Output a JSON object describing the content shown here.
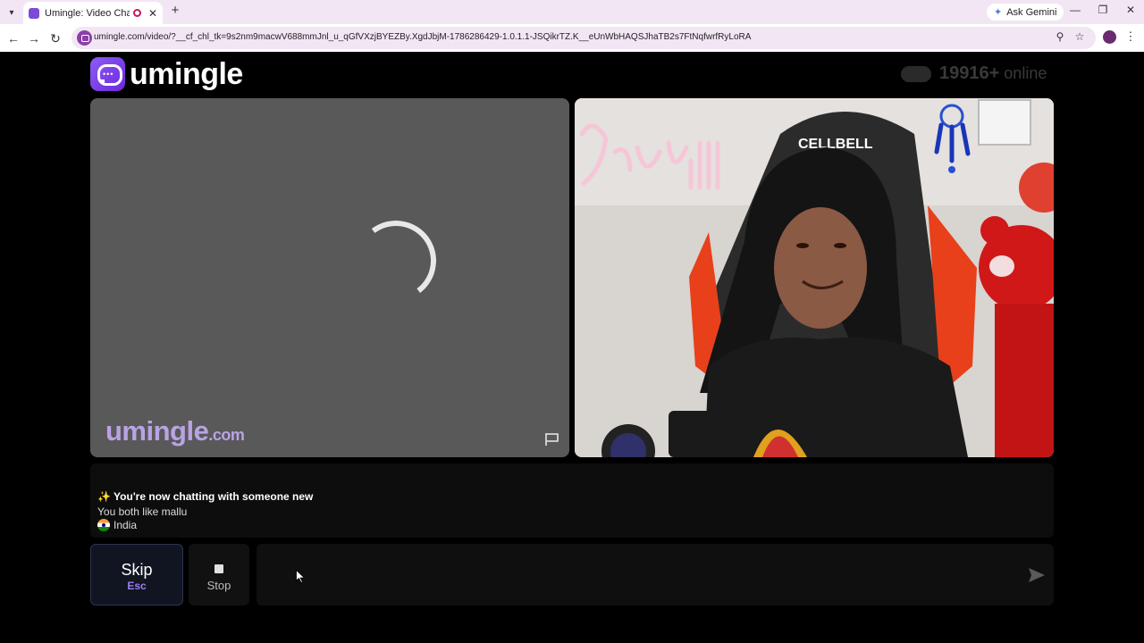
{
  "browser": {
    "tab_title": "Umingle: Video Chat with S",
    "new_tab_icon": "plus-icon",
    "ask_gemini": "Ask Gemini",
    "url": "umingle.com/video/?__cf_chl_tk=9s2nm9macwV688mmJnl_u_qGfVXzjBYEZBy.XgdJbjM-1786286429-1.0.1.1-JSQikrTZ.K__eUnWbHAQSJhaTB2s7FtNqfwrfRyLoRA"
  },
  "header": {
    "brand": "umingle",
    "online_count": "19916+",
    "online_label": "online"
  },
  "local_video": {
    "watermark_main": "umingle",
    "watermark_domain": ".com"
  },
  "chat": {
    "new_chat": "✨ You're now chatting with someone new",
    "common_interest": "You both like mallu",
    "country": "India"
  },
  "controls": {
    "skip_label": "Skip",
    "skip_key": "Esc",
    "stop_label": "Stop",
    "message_value": "",
    "message_placeholder": ""
  },
  "colors": {
    "accent": "#8b5cf6",
    "skip_key": "#9f7cf0",
    "background": "#000000",
    "panel": "#595959"
  }
}
